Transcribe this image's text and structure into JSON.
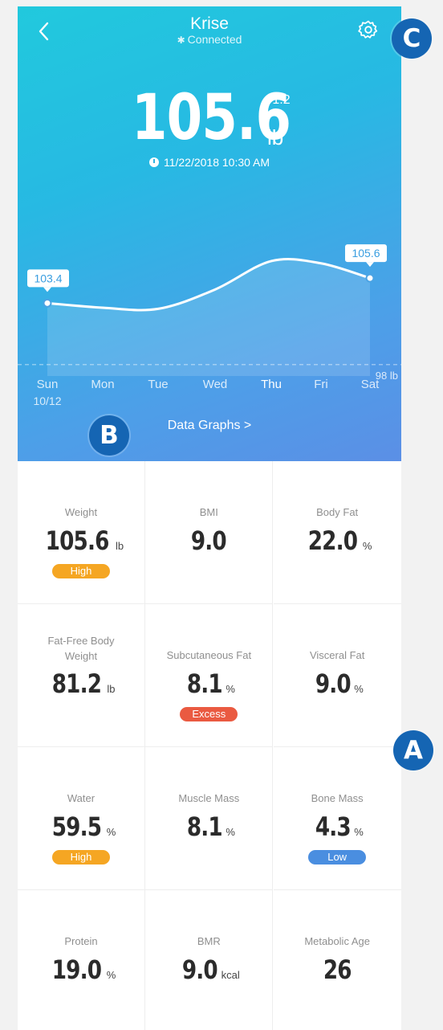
{
  "header": {
    "device_name": "Krise",
    "connection_status": "Connected",
    "bluetooth_icon": "bluetooth-icon",
    "back_icon": "chevron-left-icon",
    "settings_icon": "gear-icon"
  },
  "summary": {
    "weight": "105.6",
    "unit": "lb",
    "delta": "+1.2",
    "timestamp": "11/22/2018  10:30 AM"
  },
  "chart_data": {
    "type": "area",
    "categories": [
      "Sun",
      "Mon",
      "Tue",
      "Wed",
      "Thu",
      "Fri",
      "Sat"
    ],
    "first_date_label": "10/12",
    "series": [
      {
        "values": [
          103.4,
          103.0,
          102.9,
          104.6,
          107.1,
          106.9,
          105.6
        ]
      }
    ],
    "point_labels": [
      {
        "index": 0,
        "text": "103.4"
      },
      {
        "index": 6,
        "text": "105.6"
      }
    ],
    "reference_line": {
      "value": 98,
      "label": "98 lb"
    },
    "ylim": [
      97,
      109
    ],
    "active_category": "Thu"
  },
  "links": {
    "data_graphs": "Data Graphs >"
  },
  "metrics": [
    {
      "label": "Weight",
      "value": "105.6",
      "unit": "lb",
      "badge": "High",
      "badge_color": "#f5a623"
    },
    {
      "label": "BMI",
      "value": "9.0",
      "unit": "",
      "badge": "",
      "badge_color": ""
    },
    {
      "label": "Body Fat",
      "value": "22.0",
      "unit": "%",
      "badge": "",
      "badge_color": ""
    },
    {
      "label": "Fat-Free Body Weight",
      "value": "81.2",
      "unit": "lb",
      "badge": "",
      "badge_color": ""
    },
    {
      "label": "Subcutaneous Fat",
      "value": "8.1",
      "unit": "%",
      "badge": "Excess",
      "badge_color": "#ea5a41"
    },
    {
      "label": "Visceral Fat",
      "value": "9.0",
      "unit": "%",
      "badge": "",
      "badge_color": ""
    },
    {
      "label": "Water",
      "value": "59.5",
      "unit": "%",
      "badge": "High",
      "badge_color": "#f5a623"
    },
    {
      "label": "Muscle Mass",
      "value": "8.1",
      "unit": "%",
      "badge": "",
      "badge_color": ""
    },
    {
      "label": "Bone Mass",
      "value": "4.3",
      "unit": "%",
      "badge": "Low",
      "badge_color": "#4a8ee0"
    },
    {
      "label": "Protein",
      "value": "19.0",
      "unit": "%",
      "badge": "",
      "badge_color": ""
    },
    {
      "label": "BMR",
      "value": "9.0",
      "unit": "kcal",
      "badge": "",
      "badge_color": ""
    },
    {
      "label": "Metabolic Age",
      "value": "26",
      "unit": "",
      "badge": "",
      "badge_color": ""
    }
  ],
  "annotations": {
    "a": "A",
    "b": "B",
    "c": "C"
  },
  "colors": {
    "accent_marker": "#1565b3",
    "gradient_top": "#21c9dd",
    "gradient_bottom": "#5b8fe6"
  }
}
